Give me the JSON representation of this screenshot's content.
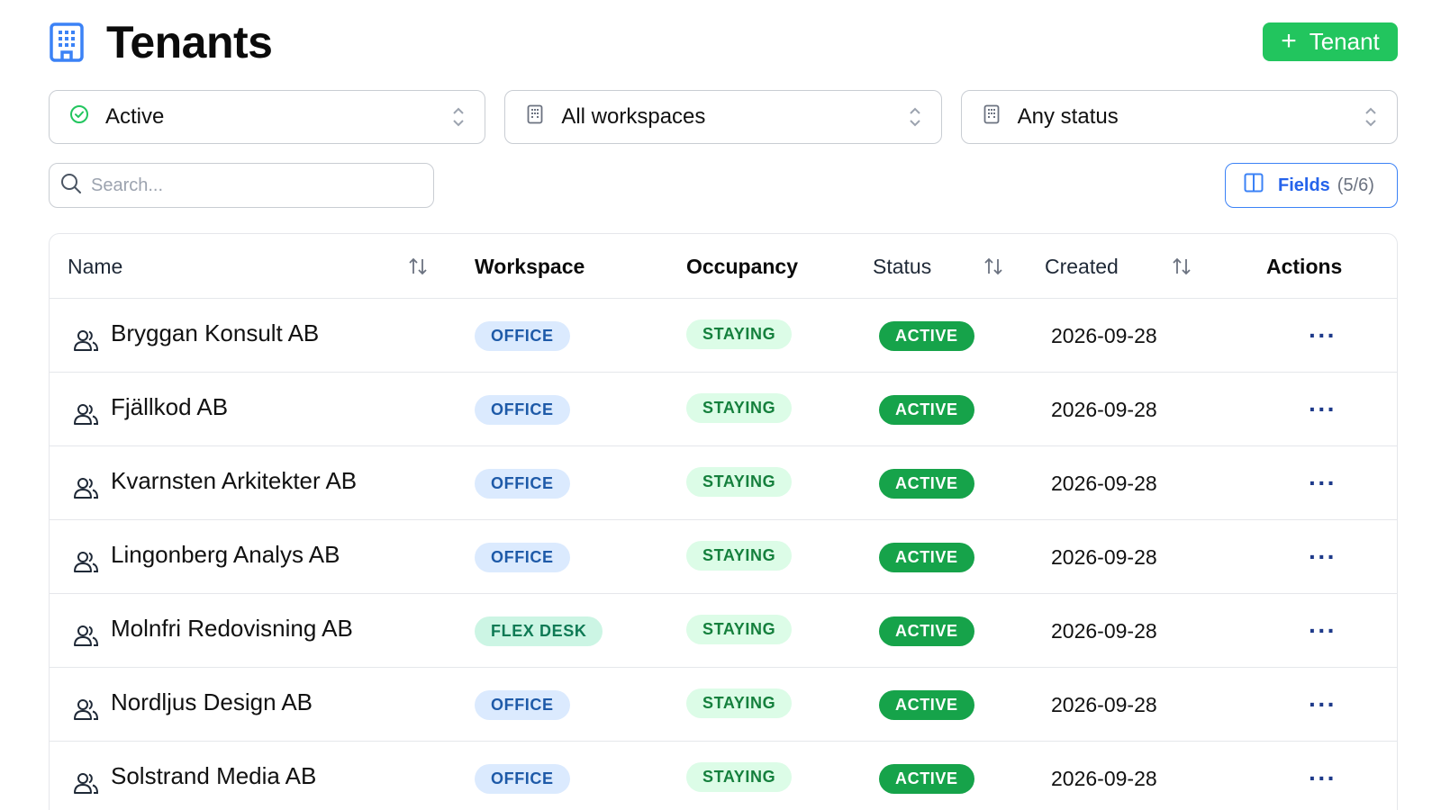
{
  "header": {
    "title": "Tenants",
    "title_icon": "building-icon",
    "add_button_label": "Tenant",
    "add_button_icon": "plus-icon",
    "accent_color": "#22c55e"
  },
  "filters": [
    {
      "label": "Active",
      "icon": "check-circle-icon"
    },
    {
      "label": "All workspaces",
      "icon": "building-icon"
    },
    {
      "label": "Any status",
      "icon": "building-icon"
    }
  ],
  "search": {
    "placeholder": "Search...",
    "value": ""
  },
  "fields_button": {
    "label": "Fields",
    "count": "(5/6)",
    "icon": "columns-icon"
  },
  "table": {
    "columns": [
      {
        "label": "Name",
        "sortable": true
      },
      {
        "label": "Workspace",
        "sortable": false
      },
      {
        "label": "Occupancy",
        "sortable": false
      },
      {
        "label": "Status",
        "sortable": true
      },
      {
        "label": "Created",
        "sortable": true
      },
      {
        "label": "Actions",
        "sortable": false
      }
    ],
    "rows": [
      {
        "name": "Bryggan Konsult AB",
        "workspace": "OFFICE",
        "workspace_type": "office",
        "occupancy": "STAYING",
        "status": "ACTIVE",
        "created": "2026-09-28",
        "actions": "···"
      },
      {
        "name": "Fjällkod AB",
        "workspace": "OFFICE",
        "workspace_type": "office",
        "occupancy": "STAYING",
        "status": "ACTIVE",
        "created": "2026-09-28",
        "actions": "···"
      },
      {
        "name": "Kvarnsten Arkitekter AB",
        "workspace": "OFFICE",
        "workspace_type": "office",
        "occupancy": "STAYING",
        "status": "ACTIVE",
        "created": "2026-09-28",
        "actions": "···"
      },
      {
        "name": "Lingonberg Analys AB",
        "workspace": "OFFICE",
        "workspace_type": "office",
        "occupancy": "STAYING",
        "status": "ACTIVE",
        "created": "2026-09-28",
        "actions": "···"
      },
      {
        "name": "Molnfri Redovisning AB",
        "workspace": "FLEX DESK",
        "workspace_type": "flex",
        "occupancy": "STAYING",
        "status": "ACTIVE",
        "created": "2026-09-28",
        "actions": "···"
      },
      {
        "name": "Nordljus Design AB",
        "workspace": "OFFICE",
        "workspace_type": "office",
        "occupancy": "STAYING",
        "status": "ACTIVE",
        "created": "2026-09-28",
        "actions": "···"
      },
      {
        "name": "Solstrand Media AB",
        "workspace": "OFFICE",
        "workspace_type": "office",
        "occupancy": "STAYING",
        "status": "ACTIVE",
        "created": "2026-09-28",
        "actions": "···"
      }
    ]
  }
}
